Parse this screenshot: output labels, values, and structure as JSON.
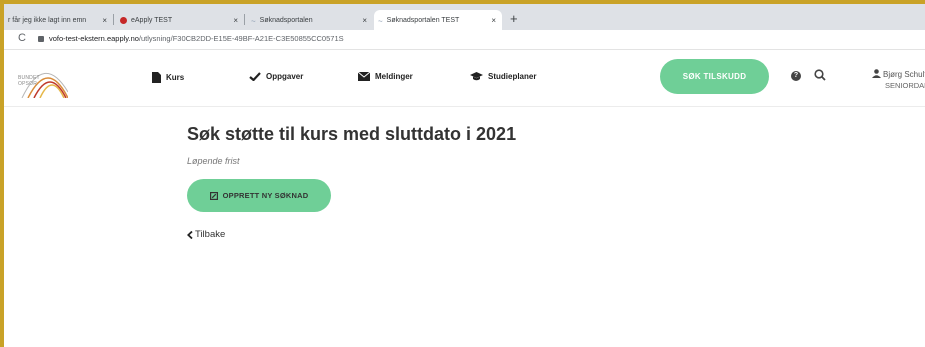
{
  "browser": {
    "tabs": [
      {
        "label": "r får jeg ikke lagt inn emn",
        "close": "×"
      },
      {
        "label": "eApply TEST",
        "close": "×"
      },
      {
        "label": "Søknadsportalen",
        "close": "×"
      },
      {
        "label": "Søknadsportalen TEST",
        "close": "×"
      }
    ],
    "new_tab": "+",
    "reload": "C",
    "url_host": "vofo-test-ekstern.eapply.no",
    "url_path": "/utlysning/F30CB2DD-E15E-49BF-A21E-C3E50855CC0571S"
  },
  "header": {
    "logo_line1": "BUNDET",
    "logo_line2": "OPSOR",
    "nav": [
      {
        "label": "Kurs",
        "icon": "document-icon"
      },
      {
        "label": "Oppgaver",
        "icon": "checkmark-icon"
      },
      {
        "label": "Meldinger",
        "icon": "envelope-icon"
      },
      {
        "label": "Studieplaner",
        "icon": "graduation-cap-icon"
      }
    ],
    "cta_label": "SØK TILSKUDD",
    "help_glyph": "?",
    "user_name": "Bjørg Schultz",
    "user_role": "SENIORDAM"
  },
  "main": {
    "title": "Søk støtte til kurs med sluttdato i 2021",
    "deadline": "Løpende frist",
    "apply_label": "OPPRETT NY SØKNAD",
    "back_label": "Tilbake"
  },
  "colors": {
    "accent_green": "#6fcf97",
    "frame_gold": "#c9a227"
  }
}
